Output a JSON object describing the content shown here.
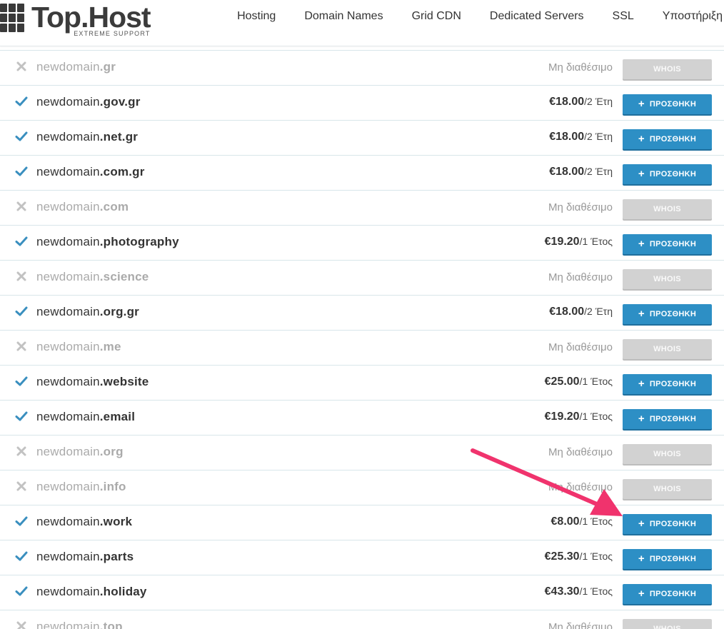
{
  "header": {
    "logo_name": "Top.Host",
    "logo_tagline": "EXTREME SUPPORT",
    "nav": [
      "Hosting",
      "Domain Names",
      "Grid CDN",
      "Dedicated Servers",
      "SSL",
      "Υποστήριξη"
    ]
  },
  "labels": {
    "add_button": "ΠΡΟΣΘΗΚΗ",
    "whois_button": "WHOIS",
    "unavailable": "Μη διαθέσιμο"
  },
  "colors": {
    "check": "#3a8fbf",
    "cross": "#c2c2c2",
    "add_button": "#2d8fc5",
    "whois_button": "#d2d2d2",
    "annotation_arrow": "#f0336d"
  },
  "domains": [
    {
      "sld": "newdomain",
      "tld": ".gr",
      "available": false
    },
    {
      "sld": "newdomain",
      "tld": ".gov.gr",
      "available": true,
      "price": "€18.00",
      "period": "/2 Έτη"
    },
    {
      "sld": "newdomain",
      "tld": ".net.gr",
      "available": true,
      "price": "€18.00",
      "period": "/2 Έτη"
    },
    {
      "sld": "newdomain",
      "tld": ".com.gr",
      "available": true,
      "price": "€18.00",
      "period": "/2 Έτη"
    },
    {
      "sld": "newdomain",
      "tld": ".com",
      "available": false
    },
    {
      "sld": "newdomain",
      "tld": ".photography",
      "available": true,
      "price": "€19.20",
      "period": "/1 Έτος"
    },
    {
      "sld": "newdomain",
      "tld": ".science",
      "available": false
    },
    {
      "sld": "newdomain",
      "tld": ".org.gr",
      "available": true,
      "price": "€18.00",
      "period": "/2 Έτη"
    },
    {
      "sld": "newdomain",
      "tld": ".me",
      "available": false
    },
    {
      "sld": "newdomain",
      "tld": ".website",
      "available": true,
      "price": "€25.00",
      "period": "/1 Έτος"
    },
    {
      "sld": "newdomain",
      "tld": ".email",
      "available": true,
      "price": "€19.20",
      "period": "/1 Έτος"
    },
    {
      "sld": "newdomain",
      "tld": ".org",
      "available": false
    },
    {
      "sld": "newdomain",
      "tld": ".info",
      "available": false
    },
    {
      "sld": "newdomain",
      "tld": ".work",
      "available": true,
      "price": "€8.00",
      "period": "/1 Έτος"
    },
    {
      "sld": "newdomain",
      "tld": ".parts",
      "available": true,
      "price": "€25.30",
      "period": "/1 Έτος"
    },
    {
      "sld": "newdomain",
      "tld": ".holiday",
      "available": true,
      "price": "€43.30",
      "period": "/1 Έτος"
    },
    {
      "sld": "newdomain",
      "tld": ".top",
      "available": false
    }
  ]
}
